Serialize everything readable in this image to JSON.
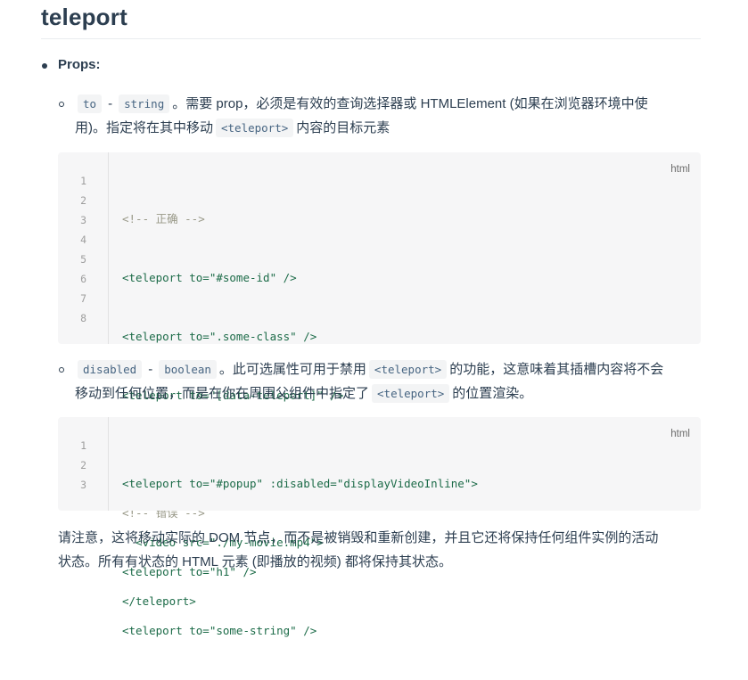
{
  "heading": "teleport",
  "props_label": "Props:",
  "prop_to": {
    "name": "to",
    "dash": "-",
    "type": "string",
    "desc_1": "。需要 prop，必须是有效的查询选择器或 HTMLElement (如果在浏览器环境中使",
    "desc_2": "用)。指定将在其中移动",
    "code_inline": "<teleport>",
    "desc_3": "内容的目标元素"
  },
  "code_block_1": {
    "lang": "html",
    "line_numbers": [
      "1",
      "2",
      "3",
      "4",
      "5",
      "6",
      "7",
      "8"
    ],
    "lines": [
      "<!-- 正确 -->",
      "<teleport to=\"#some-id\" />",
      "<teleport to=\".some-class\" />",
      "<teleport to=\"[data-teleport]\" />",
      "",
      "<!-- 错误 -->",
      "<teleport to=\"h1\" />",
      "<teleport to=\"some-string\" />"
    ]
  },
  "prop_disabled": {
    "name": "disabled",
    "dash": "-",
    "type": "boolean",
    "desc_1": "。此可选属性可用于禁用",
    "code_inline_1": "<teleport>",
    "desc_2": "的功能，这意味着其插槽内容将不会",
    "desc_3": "移动到任何位置，而是在你在周围父组件中指定了",
    "code_inline_2": "<teleport>",
    "desc_4": "的位置渲染。"
  },
  "code_block_2": {
    "lang": "html",
    "line_numbers": [
      "1",
      "2",
      "3"
    ],
    "lines": [
      "<teleport to=\"#popup\" :disabled=\"displayVideoInline\">",
      "  <video src=\"./my-movie.mp4\">",
      "</teleport>"
    ]
  },
  "note": {
    "line_1": "请注意，这将移动实际的 DOM 节点，而不是被销毁和重新创建，并且它还将保持任何组件实例的活动",
    "line_2": "状态。所有有状态的 HTML 元素 (即播放的视频) 都将保持其状态。"
  }
}
